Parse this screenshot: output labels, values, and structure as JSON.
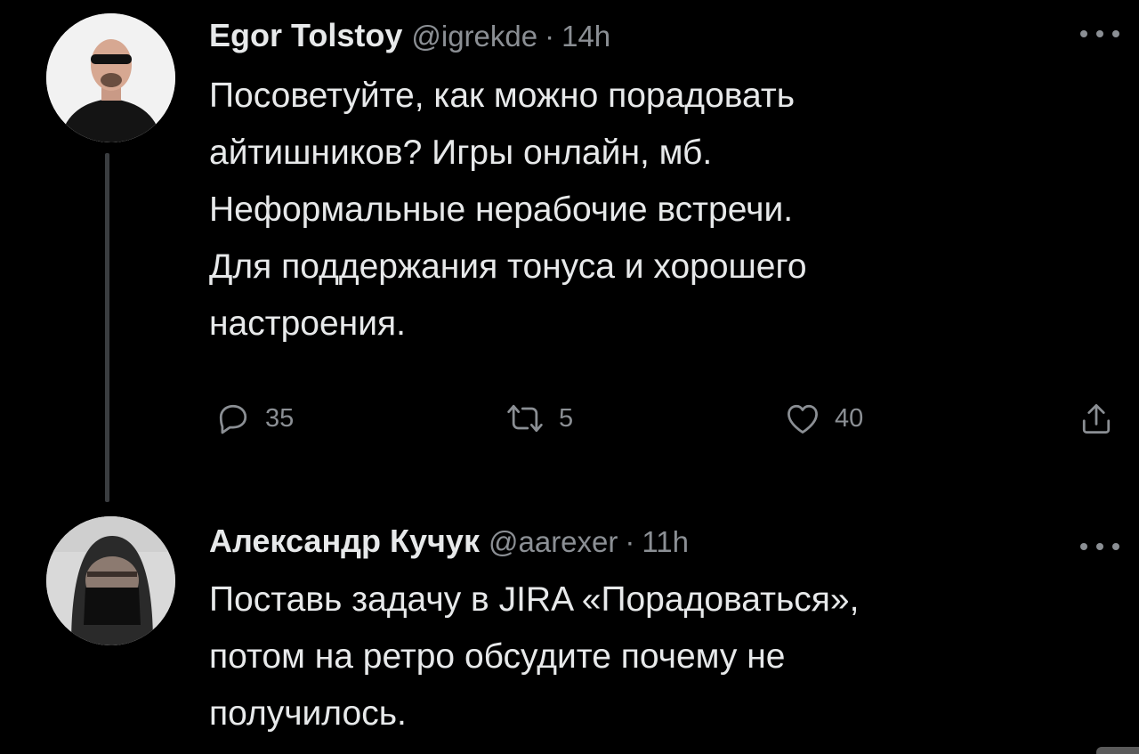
{
  "tweet1": {
    "author": "Egor Tolstoy",
    "handle": "@igrekde",
    "separator": "·",
    "time": "14h",
    "lines": [
      "Посоветуйте, как можно порадовать",
      "айтишников? Игры онлайн, мб.",
      "Неформальные нерабочие встречи.",
      "Для поддержания тонуса и хорошего",
      "настроения."
    ],
    "actions": {
      "replies": "35",
      "retweets": "5",
      "likes": "40"
    }
  },
  "tweet2": {
    "author": "Александр Кучук",
    "handle": "@aarexer",
    "separator": "·",
    "time": "11h",
    "lines": [
      "Поставь задачу в JIRA «Порадоваться»,",
      "потом на ретро обсудите почему не",
      "получилось."
    ]
  },
  "icons": {
    "reply": "reply-icon",
    "retweet": "retweet-icon",
    "like": "heart-icon",
    "share": "share-icon",
    "more": "more-icon"
  },
  "colors": {
    "background": "#000000",
    "text": "#e7e9ea",
    "secondary": "#8b8f94",
    "thread_line": "#3a3d40"
  }
}
